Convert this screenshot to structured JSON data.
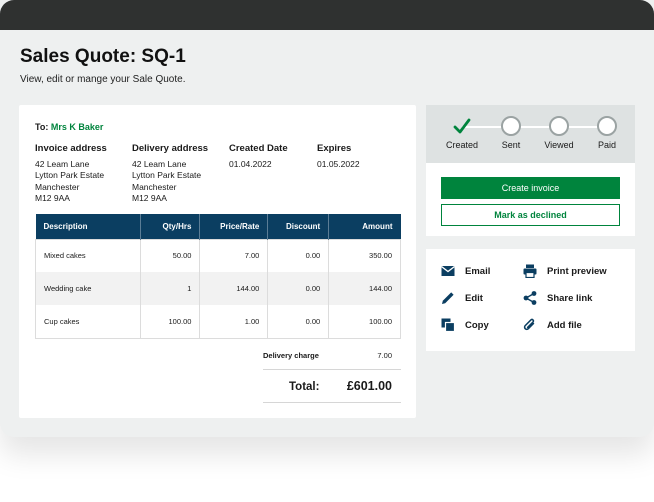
{
  "page": {
    "title": "Sales Quote: SQ-1",
    "subtitle": "View, edit or mange your Sale Quote."
  },
  "quote": {
    "to_label": "To:",
    "to_name": "Mrs K Baker",
    "invoice_address": {
      "heading": "Invoice address",
      "lines": [
        "42 Leam Lane",
        "Lytton Park Estate",
        "Manchester",
        "M12 9AA"
      ]
    },
    "delivery_address": {
      "heading": "Delivery address",
      "lines": [
        "42 Leam Lane",
        "Lytton Park Estate",
        "Manchester",
        "M12 9AA"
      ]
    },
    "created": {
      "heading": "Created Date",
      "value": "01.04.2022"
    },
    "expires": {
      "heading": "Expires",
      "value": "01.05.2022"
    },
    "table": {
      "headers": [
        "Description",
        "Qty/Hrs",
        "Price/Rate",
        "Discount",
        "Amount"
      ],
      "rows": [
        [
          "Mixed cakes",
          "50.00",
          "7.00",
          "0.00",
          "350.00"
        ],
        [
          "Wedding cake",
          "1",
          "144.00",
          "0.00",
          "144.00"
        ],
        [
          "Cup cakes",
          "100.00",
          "1.00",
          "0.00",
          "100.00"
        ]
      ]
    },
    "delivery_charge_label": "Delivery charge",
    "delivery_charge_value": "7.00",
    "total_label": "Total:",
    "total_value": "£601.00"
  },
  "status": {
    "steps": [
      "Created",
      "Sent",
      "Viewed",
      "Paid"
    ],
    "completed_steps": 1,
    "create_invoice_label": "Create invoice",
    "mark_declined_label": "Mark as declined"
  },
  "actions": {
    "email": "Email",
    "edit": "Edit",
    "copy": "Copy",
    "print_preview": "Print preview",
    "share_link": "Share link",
    "add_file": "Add file"
  },
  "colors": {
    "brand_green": "#00843d",
    "table_header_navy": "#0b3e61",
    "titlebar": "#2f3130"
  }
}
